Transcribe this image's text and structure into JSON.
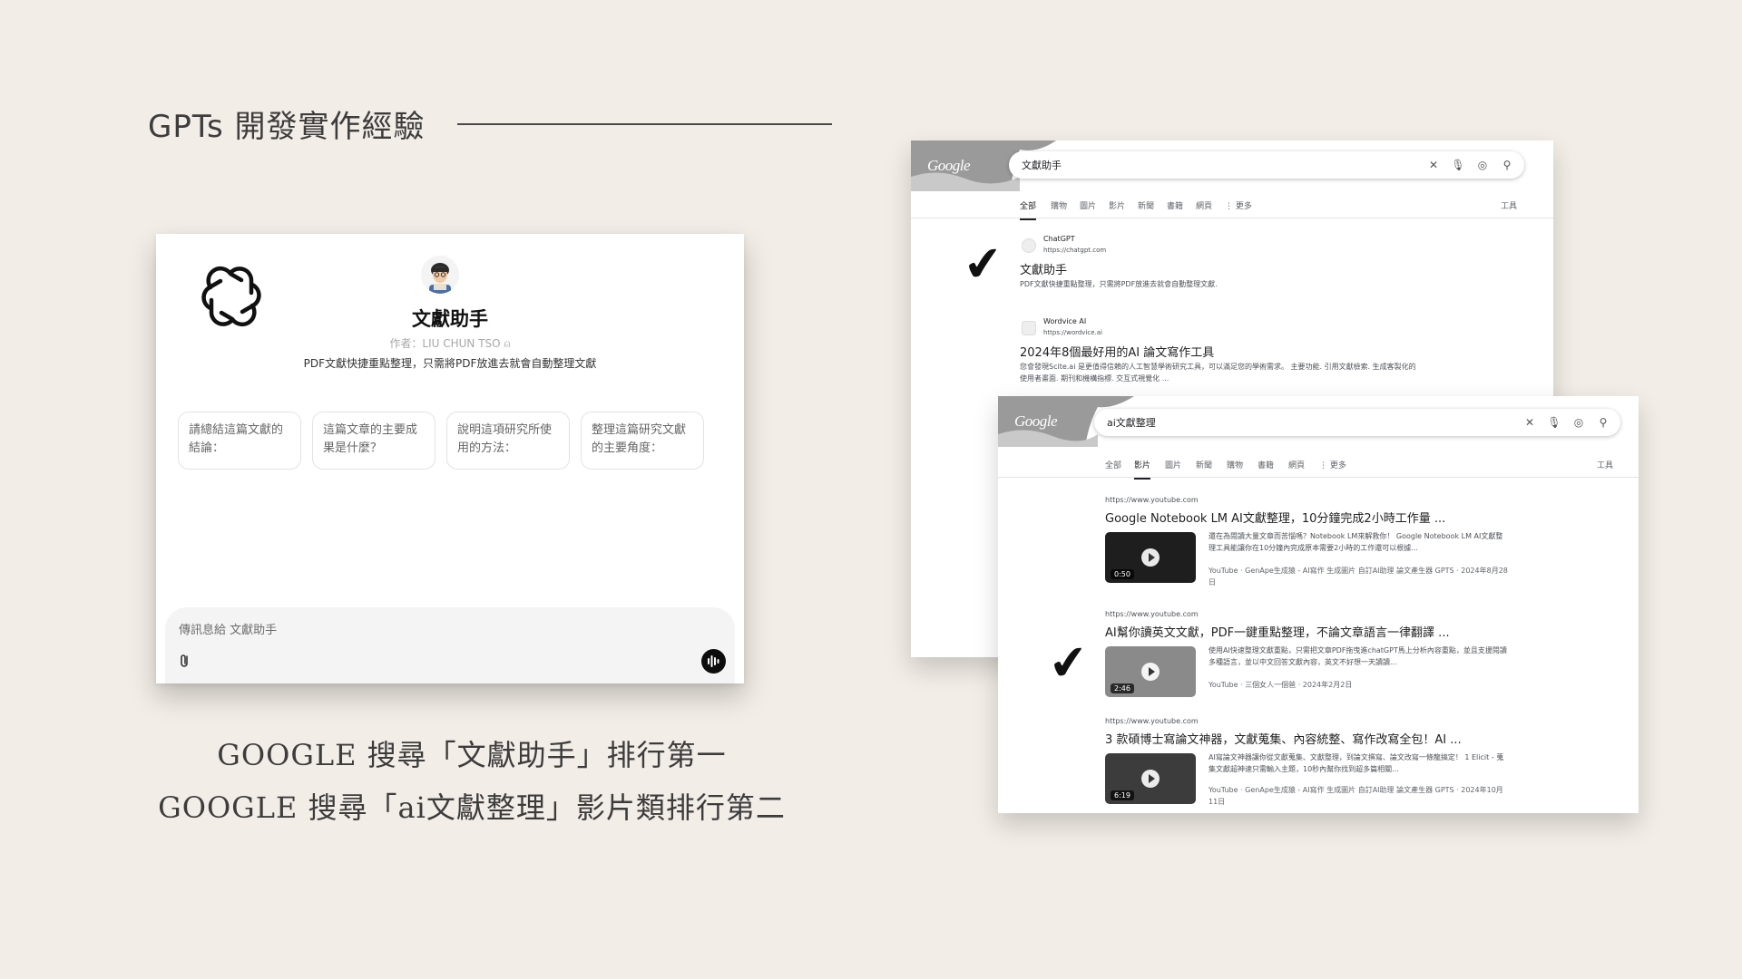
{
  "slide": {
    "title": "GPTs 開發實作經驗",
    "caption_1": "GOOGLE 搜尋「文獻助手」排行第一",
    "caption_2": "GOOGLE 搜尋「ai文獻整理」影片類排行第二"
  },
  "gpt": {
    "name": "文獻助手",
    "author": "作者：LIU CHUN TSO ⍝",
    "description": "PDF文獻快捷重點整理，只需將PDF放進去就會自動整理文獻",
    "starters": [
      "請總結這篇文獻的結論：",
      "這篇文章的主要成果是什麼？",
      "說明這項研究所使用的方法：",
      "整理這篇研究文獻的主要角度："
    ],
    "composer_placeholder": "傳訊息給 文獻助手",
    "icons": {
      "logo": "openai-logo",
      "attach": "paperclip-icon",
      "voice": "voice-icon"
    }
  },
  "search1": {
    "logo": "Google",
    "query": "文獻助手",
    "tabs": [
      "全部",
      "購物",
      "圖片",
      "影片",
      "新聞",
      "書籍",
      "網頁",
      "⋮ 更多"
    ],
    "active_tab": "全部",
    "tools": "工具",
    "results": [
      {
        "site": "ChatGPT",
        "url": "https://chatgpt.com",
        "title": "文獻助手",
        "snippet": "PDF文獻快捷重點整理，只需將PDF放進去就會自動整理文獻."
      },
      {
        "site": "Wordvice AI",
        "url": "https://wordvice.ai",
        "title": "2024年8個最好用的AI 論文寫作工具",
        "snippet": "您會發現Scite.ai 是更值得信賴的人工智慧學術研究工具，可以滿足您的學術需求。 主要功能. 引用文獻檢索. 生成客製化的使用者畫面. 期刊和機構指標. 交互式視覺化 ..."
      }
    ]
  },
  "search2": {
    "logo": "Google",
    "query": "ai文獻整理",
    "tabs": [
      "全部",
      "影片",
      "圖片",
      "新聞",
      "購物",
      "書籍",
      "網頁",
      "⋮ 更多"
    ],
    "active_tab": "影片",
    "tools": "工具",
    "videos": [
      {
        "url": "https://www.youtube.com",
        "title": "Google Notebook LM AI文獻整理，10分鐘完成2小時工作量 ...",
        "duration": "0:50",
        "snippet": "還在為閱讀大量文章而苦惱嗎？Notebook LM來解救你！ Google Notebook LM AI文獻整理工具能讓你在10分鐘內完成原本需要2小時的工作還可以根據...",
        "meta": "YouTube · GenApe生成猿 - AI寫作 生成圖片 自訂AI助理 論文產生器 GPTS · 2024年8月28日"
      },
      {
        "url": "https://www.youtube.com",
        "title": "AI幫你讀英文文獻，PDF一鍵重點整理，不論文章語言一律翻譯 ...",
        "duration": "2:46",
        "snippet": "使用AI快速整理文獻重點，只需把文章PDF拖曳進chatGPT馬上分析內容重點，並且支援閱讀多種語言，並以中文回答文獻內容，英文不好想一天讀讀...",
        "meta": "YouTube · 三個女人一個爸 · 2024年2月2日"
      },
      {
        "url": "https://www.youtube.com",
        "title": "3 款碩博士寫論文神器，文獻蒐集、內容統整、寫作改寫全包！AI ...",
        "duration": "6:19",
        "snippet": "AI寫論文神器讓你從文獻蒐集、文獻整理，到論文撰寫、論文改寫一條龍搞定！ 1 Elicit - 蒐集文獻超神速只需輸入主題，10秒內幫你找到超多篇相關...",
        "meta": "YouTube · GenApe生成猿 - AI寫作 生成圖片 自訂AI助理 論文產生器 GPTS · 2024年10月11日"
      }
    ]
  },
  "marks": {
    "check_1": "✔",
    "check_2": "✔"
  }
}
